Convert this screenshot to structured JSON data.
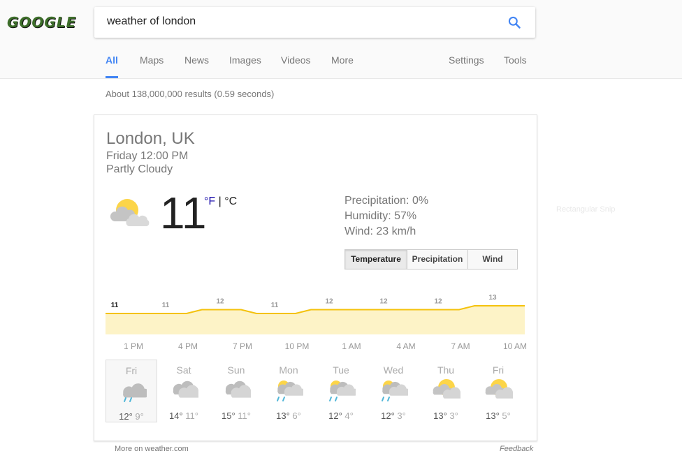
{
  "logo": "GOOGLE",
  "search": {
    "value": "weather of london"
  },
  "tabs": [
    "All",
    "Maps",
    "News",
    "Images",
    "Videos",
    "More",
    "Settings",
    "Tools"
  ],
  "stats": "About 138,000,000 results (0.59 seconds)",
  "weather": {
    "location": "London, UK",
    "datetime": "Friday 12:00 PM",
    "condition": "Partly Cloudy",
    "temperature": "11",
    "unit_f": "°F",
    "unit_sep": " | ",
    "unit_c": "°C",
    "precipitation": "Precipitation: 0%",
    "humidity": "Humidity: 57%",
    "wind": "Wind: 23 km/h",
    "buttons": [
      "Temperature",
      "Precipitation",
      "Wind"
    ]
  },
  "chart_data": {
    "type": "area",
    "x": [
      "1 PM",
      "4 PM",
      "7 PM",
      "10 PM",
      "1 AM",
      "4 AM",
      "7 AM",
      "10 AM"
    ],
    "values": [
      11,
      11,
      12,
      11,
      12,
      12,
      12,
      13
    ],
    "color": "#f4c20d"
  },
  "forecast": [
    {
      "day": "Fri",
      "icon": "rain-cloud-icon",
      "high": "12°",
      "low": "9°"
    },
    {
      "day": "Sat",
      "icon": "cloud-icon",
      "high": "14°",
      "low": "11°"
    },
    {
      "day": "Sun",
      "icon": "cloud-icon",
      "high": "15°",
      "low": "11°"
    },
    {
      "day": "Mon",
      "icon": "sun-rain-cloud-icon",
      "high": "13°",
      "low": "6°"
    },
    {
      "day": "Tue",
      "icon": "sun-rain-cloud-icon",
      "high": "12°",
      "low": "4°"
    },
    {
      "day": "Wed",
      "icon": "sun-rain-cloud-icon",
      "high": "12°",
      "low": "3°"
    },
    {
      "day": "Thu",
      "icon": "partly-cloudy-icon",
      "high": "13°",
      "low": "3°"
    },
    {
      "day": "Fri",
      "icon": "partly-cloudy-icon",
      "high": "13°",
      "low": "5°"
    }
  ],
  "footer": {
    "source": "More on weather.com",
    "feedback": "Feedback"
  },
  "ghost_label": "Rectangular Snip"
}
